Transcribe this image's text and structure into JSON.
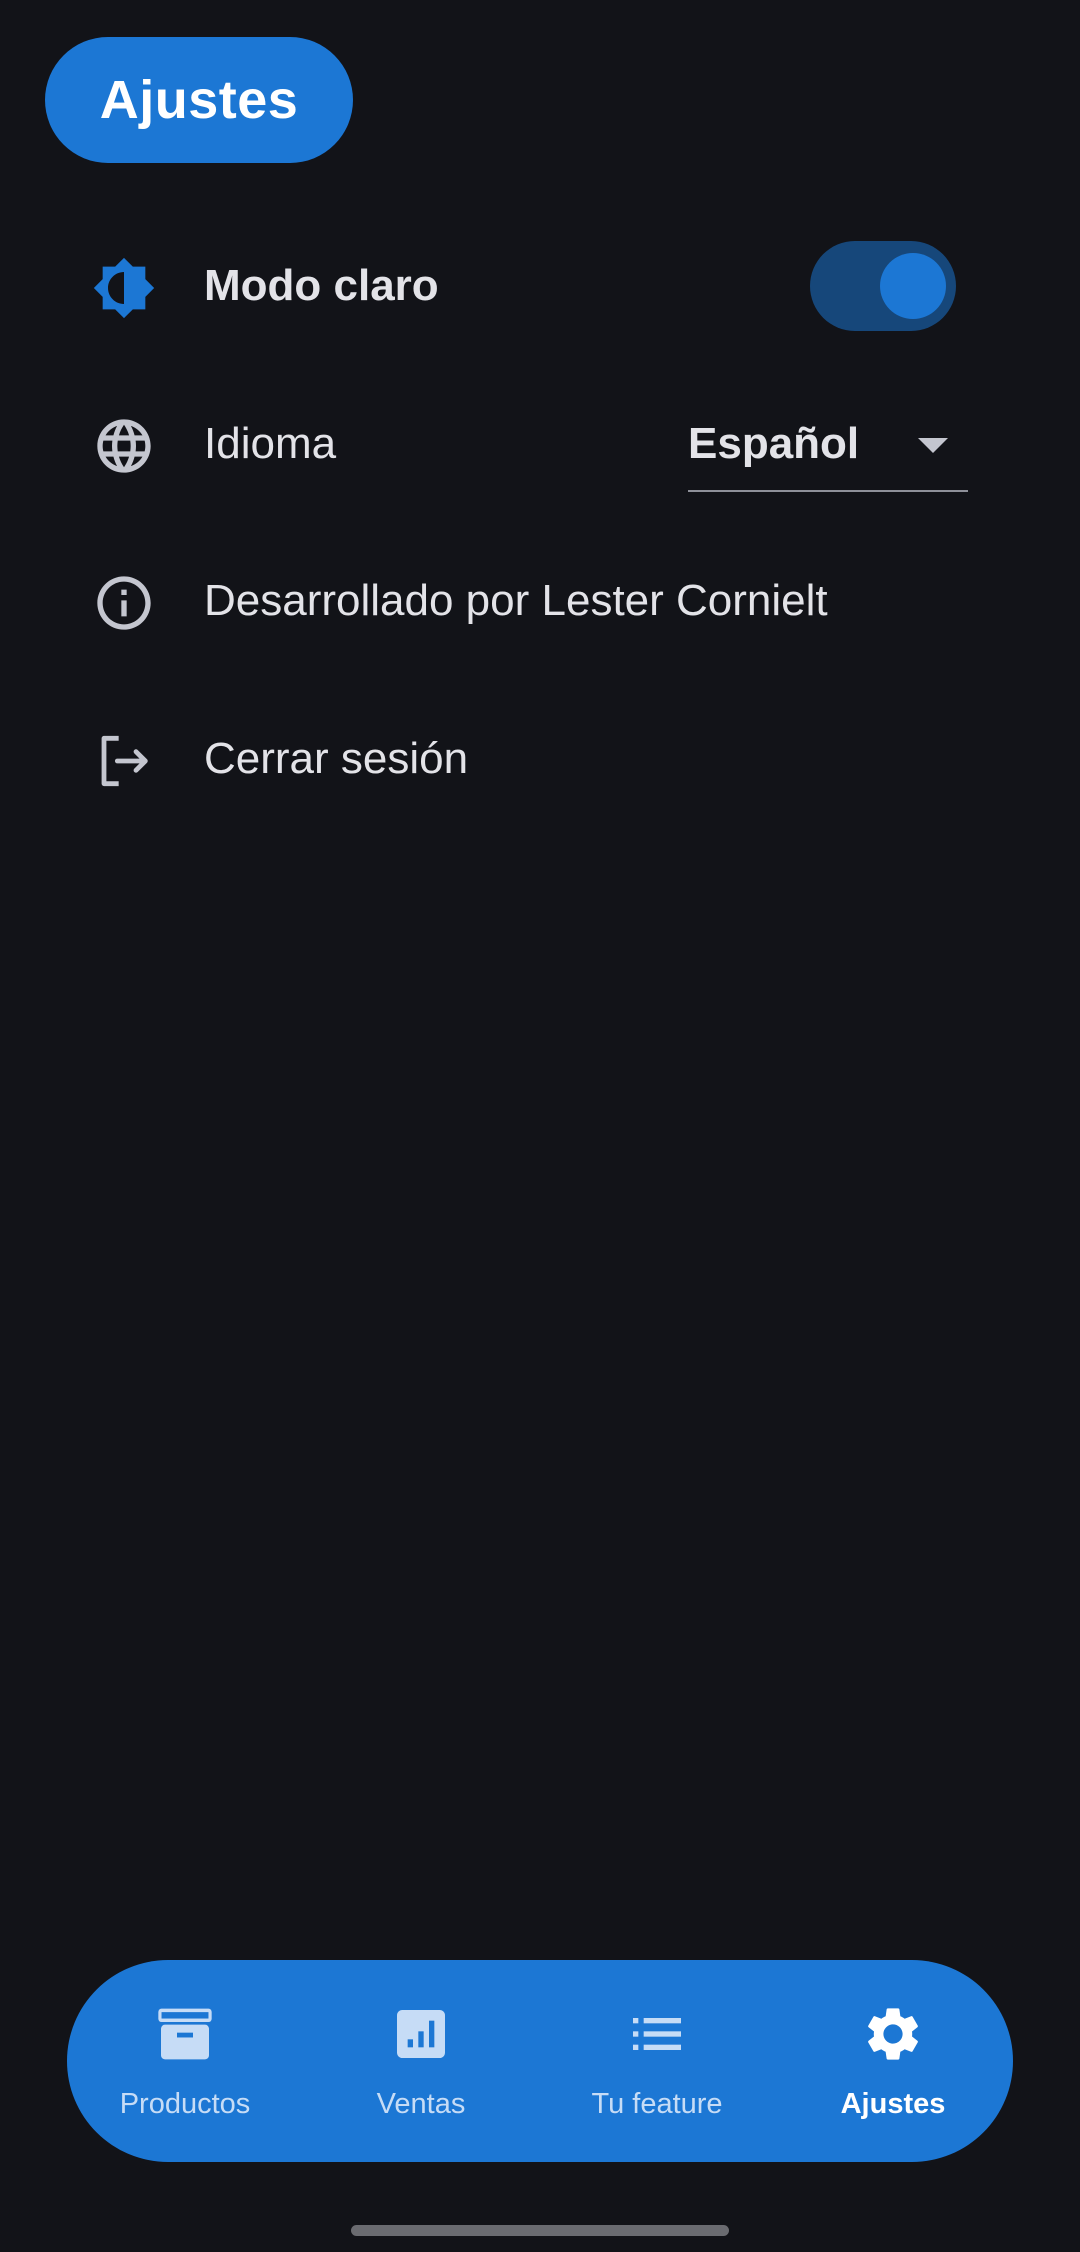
{
  "header": {
    "title": "Ajustes"
  },
  "settings": {
    "theme": {
      "label": "Modo claro",
      "icon": "brightness-icon",
      "enabled": true
    },
    "language": {
      "label": "Idioma",
      "icon": "globe-icon",
      "selected": "Español"
    },
    "about": {
      "label": "Desarrollado por Lester Cornielt",
      "icon": "info-icon"
    },
    "logout": {
      "label": "Cerrar sesión",
      "icon": "logout-icon"
    }
  },
  "bottom_nav": {
    "items": [
      {
        "label": "Productos",
        "icon": "archive-icon",
        "active": false
      },
      {
        "label": "Ventas",
        "icon": "bar-chart-icon",
        "active": false
      },
      {
        "label": "Tu feature",
        "icon": "list-icon",
        "active": false
      },
      {
        "label": "Ajustes",
        "icon": "gear-icon",
        "active": true
      }
    ]
  },
  "colors": {
    "background": "#121318",
    "accent": "#1c77d4",
    "switch_track": "#16477a",
    "text": "#e3e3e8",
    "icon_gray": "#c4c6cf"
  }
}
